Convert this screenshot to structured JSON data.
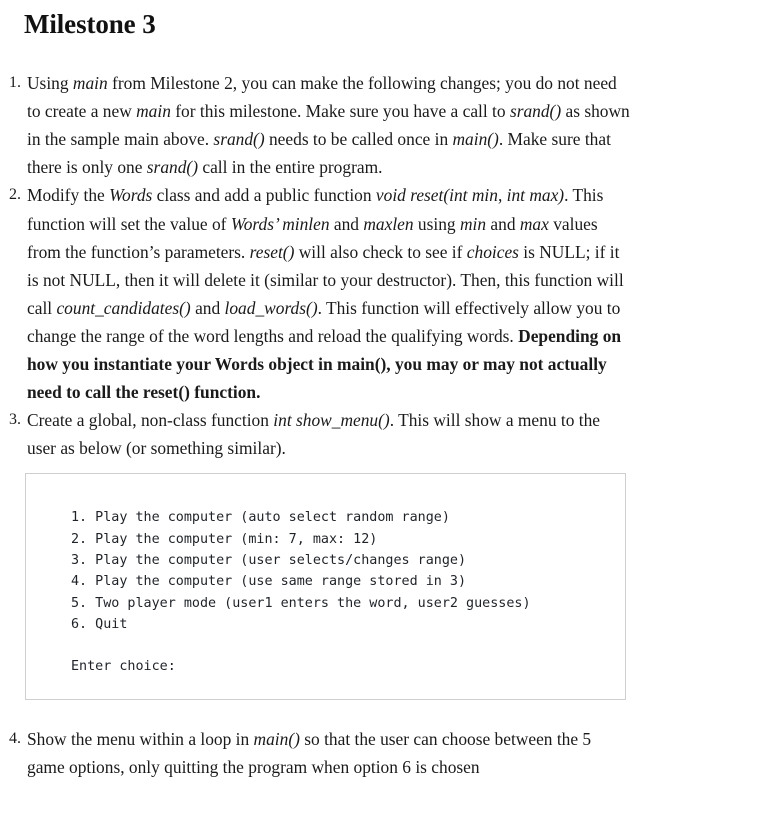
{
  "document": {
    "title": "Milestone 3"
  },
  "items": [
    {
      "marker": "1.",
      "segments": [
        {
          "text": "Using ",
          "style": "normal"
        },
        {
          "text": "main",
          "style": "italic"
        },
        {
          "text": " from Milestone 2, you can make the following changes; you do not need to create a new ",
          "style": "normal"
        },
        {
          "text": "main",
          "style": "italic"
        },
        {
          "text": " for this milestone. Make sure you have a call to ",
          "style": "normal"
        },
        {
          "text": "srand()",
          "style": "italic"
        },
        {
          "text": " as shown in the sample main above. ",
          "style": "normal"
        },
        {
          "text": "srand()",
          "style": "italic"
        },
        {
          "text": " needs to be called once in ",
          "style": "normal"
        },
        {
          "text": "main()",
          "style": "italic"
        },
        {
          "text": ". Make sure that there is only one ",
          "style": "normal"
        },
        {
          "text": "srand()",
          "style": "italic"
        },
        {
          "text": " call in the entire program.",
          "style": "normal"
        }
      ]
    },
    {
      "marker": "2.",
      "segments": [
        {
          "text": "Modify the ",
          "style": "normal"
        },
        {
          "text": "Words",
          "style": "italic"
        },
        {
          "text": " class and add a public function ",
          "style": "normal"
        },
        {
          "text": "void reset(int min, int max)",
          "style": "italic"
        },
        {
          "text": ". This function will set the value of ",
          "style": "normal"
        },
        {
          "text": "Words’ minlen",
          "style": "italic"
        },
        {
          "text": " and ",
          "style": "normal"
        },
        {
          "text": "maxlen",
          "style": "italic"
        },
        {
          "text": " using ",
          "style": "normal"
        },
        {
          "text": "min",
          "style": "italic"
        },
        {
          "text": " and ",
          "style": "normal"
        },
        {
          "text": "max",
          "style": "italic"
        },
        {
          "text": " values from the function’s parameters. ",
          "style": "normal"
        },
        {
          "text": "reset()",
          "style": "italic"
        },
        {
          "text": " will also check to see if ",
          "style": "normal"
        },
        {
          "text": "choices",
          "style": "italic"
        },
        {
          "text": " is NULL; if it is not NULL, then it will delete it (similar to your destructor). Then, this function will call ",
          "style": "normal"
        },
        {
          "text": "count_candidates()",
          "style": "italic"
        },
        {
          "text": " and ",
          "style": "normal"
        },
        {
          "text": "load_words()",
          "style": "italic"
        },
        {
          "text": ". This function will effectively allow you to change the range of the word lengths and reload the qualifying words. ",
          "style": "normal"
        },
        {
          "text": "Depending on how you instantiate your Words object in main(), you may or may not actually need to call the reset() function.",
          "style": "bold"
        }
      ]
    },
    {
      "marker": "3.",
      "segments": [
        {
          "text": "Create a global, non-class function ",
          "style": "normal"
        },
        {
          "text": "int show_menu()",
          "style": "italic"
        },
        {
          "text": ". This will show a menu to the user as below (or something similar).",
          "style": "normal"
        }
      ]
    },
    {
      "marker": "4.",
      "segments": [
        {
          "text": "Show the menu within a loop in ",
          "style": "normal"
        },
        {
          "text": "main()",
          "style": "italic"
        },
        {
          "text": " so that the user can choose between the 5 game options, only quitting the program when option 6 is chosen",
          "style": "normal"
        }
      ]
    }
  ],
  "code_block": {
    "lines": [
      "1. Play the computer (auto select random range)",
      "2. Play the computer (min: 7, max: 12)",
      "3. Play the computer (user selects/changes range)",
      "4. Play the computer (use same range stored in 3)",
      "5. Two player mode (user1 enters the word, user2 guesses)",
      "6. Quit",
      "",
      "Enter choice:"
    ]
  },
  "colors": {
    "text": "#1a1a1a",
    "title": "#111111",
    "code_text": "#1f2328",
    "code_border": "#cfcfcf",
    "background": "#ffffff"
  }
}
